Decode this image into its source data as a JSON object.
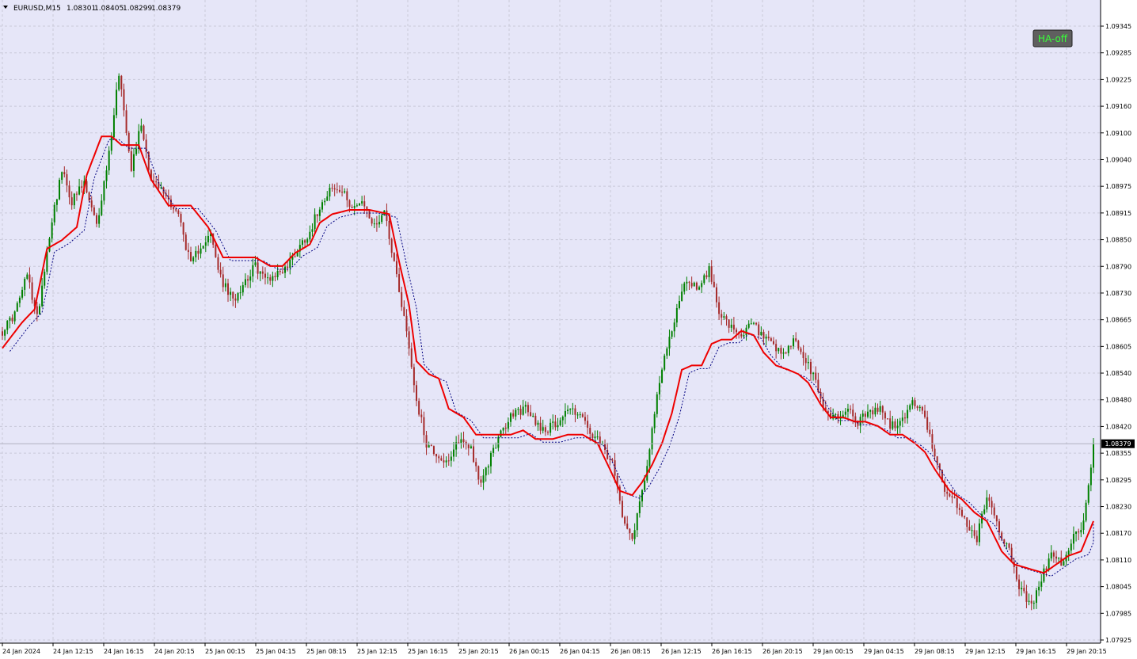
{
  "header": {
    "symbol": "EURUSD,M15",
    "open": "1.08301",
    "high": "1.08405",
    "low": "1.08299",
    "close": "1.08379"
  },
  "button": {
    "label": "HA-off",
    "color": "#38ff38"
  },
  "price_label": "1.08379",
  "colors": {
    "background": "#e6e6f8",
    "grid": "#c9c9d9",
    "bull": "#008000",
    "bear": "#a52a2a",
    "ma": "#ee0000",
    "ma_dotted": "#000080"
  },
  "chart_data": {
    "type": "candlestick",
    "title": "EURUSD,M15",
    "ylim": [
      1.07925,
      1.09345
    ],
    "y_ticks": [
      "1.09345",
      "1.09285",
      "1.09225",
      "1.09160",
      "1.09100",
      "1.09040",
      "1.08975",
      "1.08915",
      "1.08850",
      "1.08790",
      "1.08730",
      "1.08665",
      "1.08605",
      "1.08540",
      "1.08480",
      "1.08420",
      "1.08355",
      "1.08295",
      "1.08230",
      "1.08170",
      "1.08110",
      "1.08045",
      "1.07985",
      "1.07925"
    ],
    "x_ticks": [
      "24 Jan 2024",
      "24 Jan 12:15",
      "24 Jan 16:15",
      "24 Jan 20:15",
      "25 Jan 00:15",
      "25 Jan 04:15",
      "25 Jan 08:15",
      "25 Jan 12:15",
      "25 Jan 16:15",
      "25 Jan 20:15",
      "26 Jan 00:15",
      "26 Jan 04:15",
      "26 Jan 08:15",
      "26 Jan 12:15",
      "26 Jan 16:15",
      "26 Jan 20:15",
      "29 Jan 00:15",
      "29 Jan 04:15",
      "29 Jan 08:15",
      "29 Jan 12:15",
      "29 Jan 16:15",
      "29 Jan 20:15"
    ],
    "grid": true,
    "last_close": 1.08379,
    "close_path": [
      [
        0,
        1.0864
      ],
      [
        5,
        1.0868
      ],
      [
        10,
        1.0877
      ],
      [
        14,
        1.0867
      ],
      [
        20,
        1.089
      ],
      [
        24,
        1.0901
      ],
      [
        28,
        1.0894
      ],
      [
        33,
        1.0898
      ],
      [
        38,
        1.0888
      ],
      [
        43,
        1.0905
      ],
      [
        47,
        1.0924
      ],
      [
        52,
        1.0902
      ],
      [
        56,
        1.0912
      ],
      [
        60,
        1.0899
      ],
      [
        65,
        1.0896
      ],
      [
        71,
        1.0891
      ],
      [
        76,
        1.0879
      ],
      [
        80,
        1.0884
      ],
      [
        84,
        1.0886
      ],
      [
        88,
        1.0876
      ],
      [
        93,
        1.0871
      ],
      [
        97,
        1.0875
      ],
      [
        102,
        1.0879
      ],
      [
        106,
        1.0876
      ],
      [
        110,
        1.0877
      ],
      [
        115,
        1.0879
      ],
      [
        119,
        1.0883
      ],
      [
        124,
        1.0887
      ],
      [
        128,
        1.0893
      ],
      [
        132,
        1.0897
      ],
      [
        137,
        1.0896
      ],
      [
        141,
        1.0893
      ],
      [
        146,
        1.0893
      ],
      [
        150,
        1.0888
      ],
      [
        154,
        1.0892
      ],
      [
        158,
        1.088
      ],
      [
        163,
        1.0864
      ],
      [
        167,
        1.0848
      ],
      [
        171,
        1.0838
      ],
      [
        176,
        1.0835
      ],
      [
        180,
        1.0833
      ],
      [
        184,
        1.0839
      ],
      [
        189,
        1.0837
      ],
      [
        193,
        1.0828
      ],
      [
        198,
        1.0837
      ],
      [
        202,
        1.0841
      ],
      [
        206,
        1.0845
      ],
      [
        211,
        1.0846
      ],
      [
        215,
        1.0843
      ],
      [
        219,
        1.0841
      ],
      [
        224,
        1.0843
      ],
      [
        228,
        1.0846
      ],
      [
        233,
        1.0845
      ],
      [
        237,
        1.084
      ],
      [
        241,
        1.0838
      ],
      [
        246,
        1.0833
      ],
      [
        250,
        1.0822
      ],
      [
        254,
        1.0816
      ],
      [
        259,
        1.083
      ],
      [
        263,
        1.0845
      ],
      [
        267,
        1.0858
      ],
      [
        272,
        1.0869
      ],
      [
        276,
        1.0876
      ],
      [
        280,
        1.0874
      ],
      [
        285,
        1.0878
      ],
      [
        289,
        1.0869
      ],
      [
        293,
        1.0865
      ],
      [
        298,
        1.0862
      ],
      [
        302,
        1.0866
      ],
      [
        306,
        1.0863
      ],
      [
        311,
        1.086
      ],
      [
        315,
        1.0858
      ],
      [
        319,
        1.0862
      ],
      [
        324,
        1.0857
      ],
      [
        328,
        1.0852
      ],
      [
        332,
        1.0845
      ],
      [
        337,
        1.0844
      ],
      [
        341,
        1.0846
      ],
      [
        345,
        1.0843
      ],
      [
        350,
        1.0845
      ],
      [
        354,
        1.0846
      ],
      [
        358,
        1.0842
      ],
      [
        363,
        1.0843
      ],
      [
        367,
        1.0848
      ],
      [
        371,
        1.0845
      ],
      [
        376,
        1.0836
      ],
      [
        380,
        1.0826
      ],
      [
        385,
        1.0824
      ],
      [
        389,
        1.0819
      ],
      [
        393,
        1.0816
      ],
      [
        397,
        1.0826
      ],
      [
        402,
        1.0818
      ],
      [
        406,
        1.0813
      ],
      [
        410,
        1.0805
      ],
      [
        415,
        1.08
      ],
      [
        419,
        1.0807
      ],
      [
        423,
        1.0812
      ],
      [
        428,
        1.081
      ],
      [
        432,
        1.0816
      ],
      [
        436,
        1.082
      ],
      [
        440,
        1.0837
      ]
    ],
    "ma_series": {
      "name": "",
      "points": [
        [
          0,
          1.086
        ],
        [
          8,
          1.0866
        ],
        [
          13,
          1.0869
        ],
        [
          18,
          1.0883
        ],
        [
          24,
          1.0885
        ],
        [
          30,
          1.0888
        ],
        [
          34,
          1.09
        ],
        [
          40,
          1.0909
        ],
        [
          44,
          1.0909
        ],
        [
          48,
          1.0907
        ],
        [
          55,
          1.0907
        ],
        [
          60,
          1.0899
        ],
        [
          67,
          1.0893
        ],
        [
          76,
          1.0893
        ],
        [
          83,
          1.0888
        ],
        [
          89,
          1.0881
        ],
        [
          95,
          1.0881
        ],
        [
          102,
          1.0881
        ],
        [
          108,
          1.0879
        ],
        [
          113,
          1.0879
        ],
        [
          118,
          1.0882
        ],
        [
          124,
          1.0884
        ],
        [
          128,
          1.0889
        ],
        [
          133,
          1.0891
        ],
        [
          140,
          1.0892
        ],
        [
          148,
          1.0892
        ],
        [
          156,
          1.0891
        ],
        [
          160,
          1.088
        ],
        [
          164,
          1.087
        ],
        [
          167,
          1.0857
        ],
        [
          172,
          1.0854
        ],
        [
          176,
          1.0853
        ],
        [
          180,
          1.0846
        ],
        [
          186,
          1.0844
        ],
        [
          191,
          1.084
        ],
        [
          198,
          1.084
        ],
        [
          205,
          1.084
        ],
        [
          210,
          1.0841
        ],
        [
          215,
          1.0839
        ],
        [
          222,
          1.0839
        ],
        [
          228,
          1.084
        ],
        [
          234,
          1.084
        ],
        [
          240,
          1.0838
        ],
        [
          245,
          1.0832
        ],
        [
          249,
          1.0827
        ],
        [
          254,
          1.0826
        ],
        [
          258,
          1.0829
        ],
        [
          262,
          1.0833
        ],
        [
          266,
          1.0838
        ],
        [
          270,
          1.0845
        ],
        [
          274,
          1.0855
        ],
        [
          278,
          1.0856
        ],
        [
          282,
          1.0856
        ],
        [
          286,
          1.0861
        ],
        [
          290,
          1.0862
        ],
        [
          294,
          1.0862
        ],
        [
          298,
          1.0864
        ],
        [
          303,
          1.0863
        ],
        [
          307,
          1.0859
        ],
        [
          312,
          1.0856
        ],
        [
          317,
          1.0855
        ],
        [
          321,
          1.0854
        ],
        [
          325,
          1.0852
        ],
        [
          330,
          1.0847
        ],
        [
          334,
          1.0844
        ],
        [
          339,
          1.0844
        ],
        [
          344,
          1.0843
        ],
        [
          348,
          1.0843
        ],
        [
          353,
          1.0842
        ],
        [
          358,
          1.084
        ],
        [
          363,
          1.084
        ],
        [
          368,
          1.0838
        ],
        [
          372,
          1.0836
        ],
        [
          376,
          1.0832
        ],
        [
          382,
          1.0827
        ],
        [
          387,
          1.0825
        ],
        [
          392,
          1.0822
        ],
        [
          397,
          1.082
        ],
        [
          403,
          1.0813
        ],
        [
          408,
          1.081
        ],
        [
          414,
          1.0809
        ],
        [
          420,
          1.0808
        ],
        [
          425,
          1.081
        ],
        [
          430,
          1.0812
        ],
        [
          435,
          1.0813
        ],
        [
          440,
          1.082
        ]
      ]
    }
  }
}
